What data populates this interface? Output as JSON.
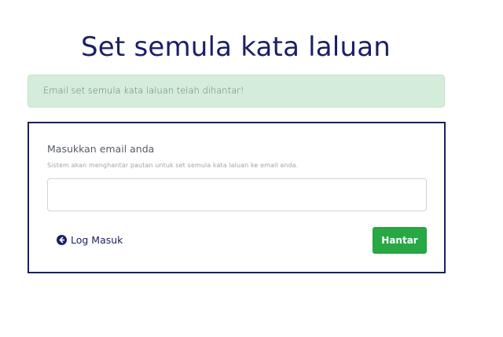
{
  "header": {
    "title": "Set semula kata laluan"
  },
  "alert": {
    "message": "Email set semula kata laluan telah dihantar!"
  },
  "form": {
    "email_label": "Masukkan email anda",
    "helper_text": "Sistem akan menghantar pautan untuk set semula kata laluan ke email anda.",
    "email_value": "",
    "back_link_label": "Log Masuk",
    "back_icon": "arrow-circle-left-icon",
    "submit_label": "Hantar"
  },
  "colors": {
    "primary": "#1b1f66",
    "success": "#28a745",
    "alert_bg": "#d4ecda"
  }
}
